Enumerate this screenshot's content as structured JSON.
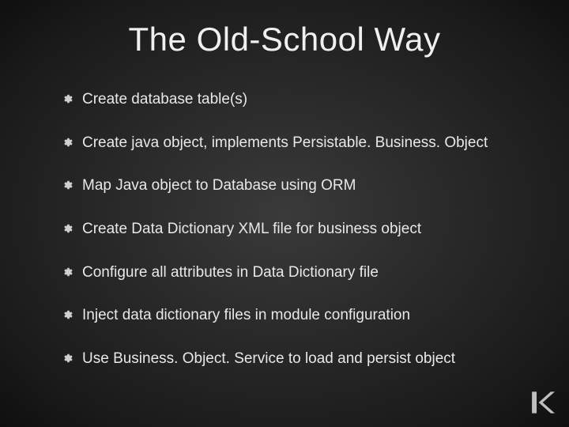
{
  "slide": {
    "title": "The Old-School Way",
    "bullets": [
      "Create database table(s)",
      "Create java object, implements Persistable. Business. Object",
      "Map Java object to Database using ORM",
      "Create Data Dictionary XML file for business object",
      "Configure all attributes in Data Dictionary file",
      "Inject data dictionary files in module configuration",
      "Use Business. Object. Service to load and persist object"
    ]
  }
}
